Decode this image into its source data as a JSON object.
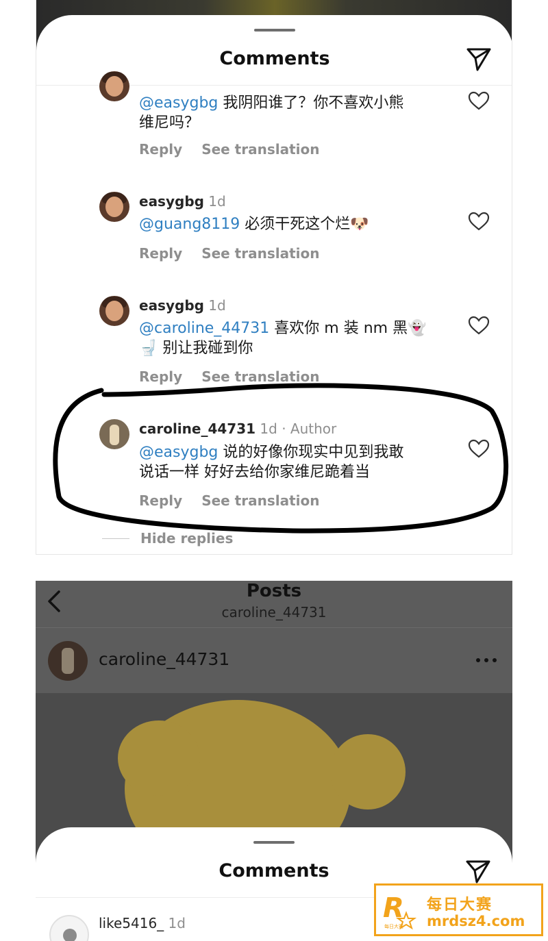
{
  "top_sheet": {
    "title": "Comments",
    "comments": [
      {
        "username": "",
        "time": "",
        "mention": "@easygbg",
        "text_line1": " 我阴阳谁了？你不喜欢小熊",
        "text_line2": "维尼吗？",
        "reply_label": "Reply",
        "translate_label": "See translation"
      },
      {
        "username": "easygbg",
        "time": " 1d",
        "mention": "@guang8119",
        "text_line1": " 必须干死这个烂🐶",
        "text_line2": "",
        "reply_label": "Reply",
        "translate_label": "See translation"
      },
      {
        "username": "easygbg",
        "time": " 1d",
        "mention": "@caroline_44731",
        "text_line1": " 喜欢你 m 装 nm 黑👻",
        "text_line2": "🚽 别让我碰到你",
        "reply_label": "Reply",
        "translate_label": "See translation"
      },
      {
        "username": "caroline_44731",
        "time": " 1d · Author",
        "mention": "@easygbg",
        "text_line1": " 说的好像你现实中见到我敢",
        "text_line2": "说话一样 好好去给你家维尼跪着当",
        "reply_label": "Reply",
        "translate_label": "See translation"
      }
    ],
    "hide_replies": "Hide replies"
  },
  "posts_screen": {
    "title": "Posts",
    "subtitle": "caroline_44731",
    "post_username": "caroline_44731"
  },
  "bottom_sheet": {
    "title": "Comments",
    "comment": {
      "username": "like5416_",
      "time": " 1d"
    }
  },
  "watermark": {
    "title": "每日大赛",
    "url": "mrdsz4.com",
    "logo_text": "每日大赛"
  },
  "colors": {
    "mention": "#2f7fc1",
    "muted": "#8e8e8e",
    "watermark": "#f2a31b"
  },
  "icons": [
    "send-icon",
    "heart-icon",
    "back-chevron-icon",
    "more-icon"
  ]
}
